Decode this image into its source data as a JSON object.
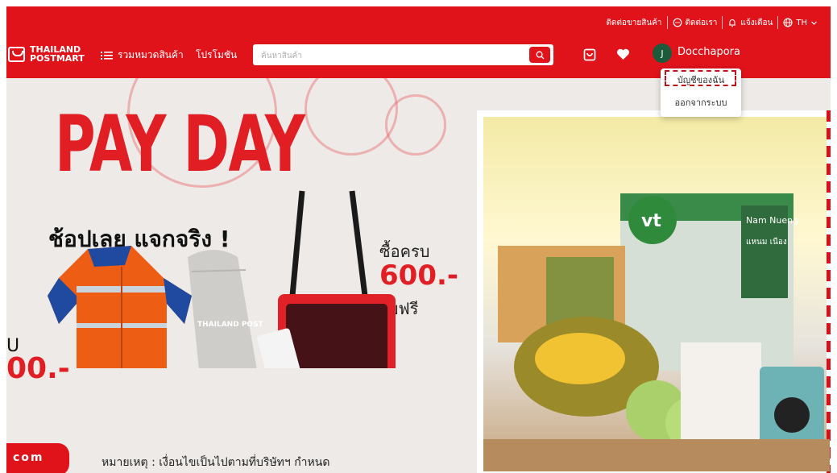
{
  "colors": {
    "brand_red": "#e0131b",
    "banner_bg": "#edeae7",
    "payday_red": "#e01e24",
    "avatar_green": "#1d5a3c"
  },
  "topbar": {
    "sell": "ติดต่อขายสินค้า",
    "contact": "ติดต่อเรา",
    "notify": "แจ้งเตือน",
    "lang": "TH"
  },
  "header": {
    "logo_line1": "THAILAND",
    "logo_line2": "POSTMART",
    "categories": "รวมหมวดสินค้า",
    "promotions": "โปรโมชัน",
    "search_placeholder": "ค้นหาสินค้า",
    "avatar_initial": "J",
    "username": "Docchapora"
  },
  "dropdown": {
    "my_account": "บัญชีของฉัน",
    "logout": "ออกจากระบบ"
  },
  "banner": {
    "headline": "PAY DAY",
    "subheadline": "ช้อปเลย แจกจริง !",
    "buy_label": "ซื้อครบ",
    "amount": "600.-",
    "free_label": "รับฟรี",
    "left_u": "U",
    "left_price": "00.-",
    "note": "หมายเหตุ : เงื่อนไขเป็นไปตามที่บริษัทฯ กำหนด",
    "com_tag": "com",
    "jacket_tag": "THAILAND POST",
    "box_brand": "vt",
    "box_label": "Nam Nueng",
    "box_label_th": "แหนม เนือง"
  },
  "icons": [
    "menu-icon",
    "search-icon",
    "cart-icon",
    "heart-icon",
    "chat-icon",
    "bell-icon",
    "globe-icon",
    "chevron-down-icon"
  ]
}
